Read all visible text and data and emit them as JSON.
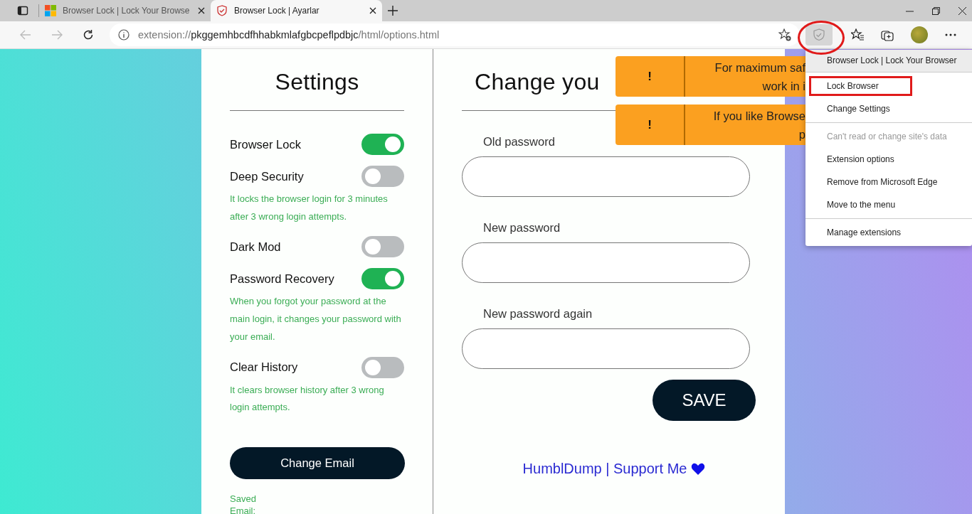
{
  "browser": {
    "tabs": [
      {
        "title": "Browser Lock | Lock Your Browse",
        "selected": false
      },
      {
        "title": "Browser Lock | Ayarlar",
        "selected": true
      }
    ],
    "address": {
      "scheme": "extension://",
      "host": "pkggemhbcdfhhabkmlafgbcpeflpdbjc",
      "path": "/html/options.html"
    },
    "extension_button": {
      "highlighted": true
    }
  },
  "settings": {
    "title": "Settings",
    "toggles": [
      {
        "label": "Browser Lock",
        "on": true
      },
      {
        "label": "Deep Security",
        "on": false,
        "description": "It locks the browser login for 3 minutes after 3 wrong login attempts."
      },
      {
        "label": "Dark Mod",
        "on": false
      },
      {
        "label": "Password Recovery",
        "on": true,
        "description": "When you forgot your password at the main login, it changes your password with your email."
      },
      {
        "label": "Clear History",
        "on": false,
        "description": "It clears browser history after 3 wrong login attempts."
      }
    ],
    "change_email_button": "Change Email",
    "saved_email_label": "Saved Email:"
  },
  "password": {
    "title": "Change you",
    "fields": [
      {
        "label": "Old password"
      },
      {
        "label": "New password"
      },
      {
        "label": "New password again"
      }
    ],
    "save_button": "SAVE",
    "support_link": "HumblDump | Support Me"
  },
  "toasts": [
    {
      "icon": "!",
      "lines": [
        "For maximum saf",
        "work in i"
      ]
    },
    {
      "icon": "!",
      "lines": [
        "If you like Browse",
        "p"
      ]
    }
  ],
  "menu": {
    "header": "Browser Lock | Lock Your Browser",
    "groups": [
      [
        {
          "label": "Lock Browser",
          "disabled": false,
          "highlighted": true
        },
        {
          "label": "Change Settings",
          "disabled": false,
          "highlighted": false
        }
      ],
      [
        {
          "label": "Can't read or change site's data",
          "disabled": true,
          "highlighted": false
        },
        {
          "label": "Extension options",
          "disabled": false,
          "highlighted": false
        },
        {
          "label": "Remove from Microsoft Edge",
          "disabled": false,
          "highlighted": false
        },
        {
          "label": "Move to the menu",
          "disabled": false,
          "highlighted": false
        }
      ],
      [
        {
          "label": "Manage extensions",
          "disabled": false,
          "highlighted": false
        }
      ]
    ]
  }
}
